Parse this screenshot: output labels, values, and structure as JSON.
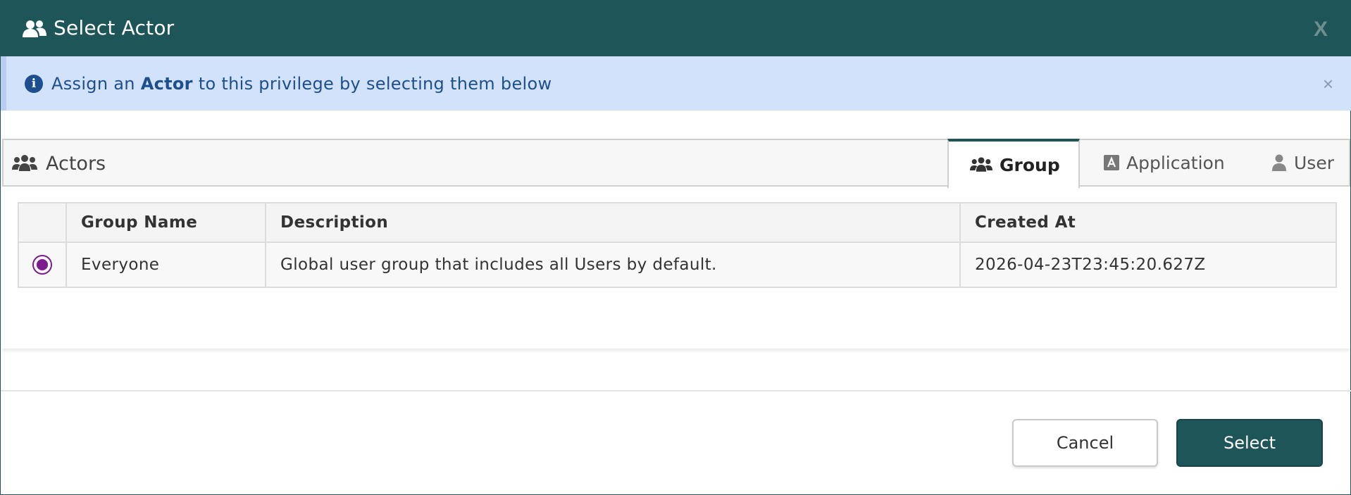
{
  "dialog": {
    "title": "Select Actor",
    "close_label": "X",
    "header_icon": "users-icon",
    "header_color": "#1e5559"
  },
  "alert": {
    "text_before": "Assign an ",
    "text_bold": "Actor",
    "text_after": " to this privilege by selecting them below",
    "dismiss_label": "×",
    "icon": "info-icon",
    "background": "#d3e2fb"
  },
  "panel": {
    "title": "Actors",
    "icon": "users-icon",
    "tabs": [
      {
        "label": "Group",
        "icon": "users-icon",
        "active": true
      },
      {
        "label": "Application",
        "icon": "application-icon",
        "active": false
      },
      {
        "label": "User",
        "icon": "user-icon",
        "active": false
      }
    ]
  },
  "table": {
    "columns": [
      "",
      "Group Name",
      "Description",
      "Created At"
    ],
    "rows": [
      {
        "selected": true,
        "group_name": "Everyone",
        "description": "Global user group that includes all Users by default.",
        "created_at": "2026-04-23T23:45:20.627Z"
      }
    ],
    "radio_color": "#7b1b8e"
  },
  "footer": {
    "cancel_label": "Cancel",
    "select_label": "Select"
  }
}
